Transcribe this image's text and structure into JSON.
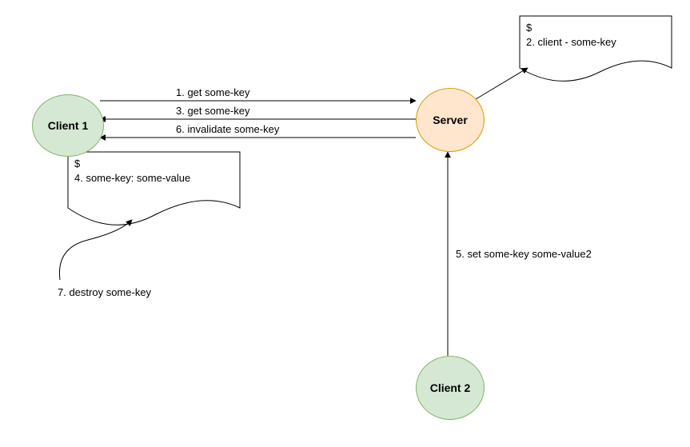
{
  "nodes": {
    "client1": "Client 1",
    "client2": "Client 2",
    "server": "Server"
  },
  "notes": {
    "server_note": {
      "dollar": "$",
      "line": "2. client  -  some-key"
    },
    "client_note": {
      "dollar": "$",
      "line": "4. some-key: some-value"
    }
  },
  "edges": {
    "e1": "1. get some-key",
    "e3": "3. get some-key",
    "e6": "6. invalidate some-key",
    "e5": "5. set some-key some-value2",
    "e7": "7. destroy some-key"
  }
}
